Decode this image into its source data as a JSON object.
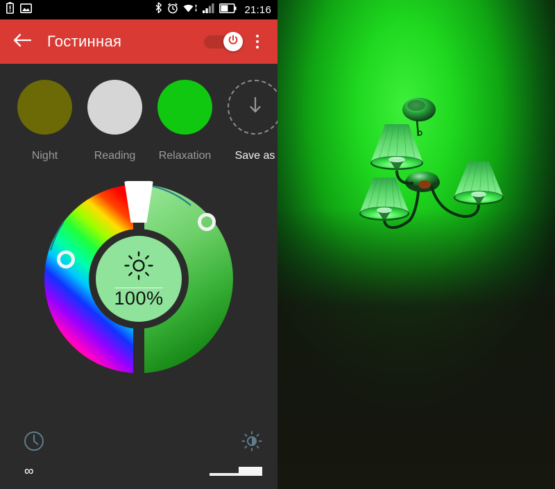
{
  "statusbar": {
    "icons_left": [
      "battery-alert-icon",
      "screenshot-icon"
    ],
    "icons_right": [
      "bluetooth-icon",
      "alarm-icon",
      "wifi-icon",
      "signal-icon",
      "battery-icon"
    ],
    "time": "21:16"
  },
  "appbar": {
    "back_icon": "back-arrow-icon",
    "title": "Гостинная",
    "power_toggle": {
      "state": "on",
      "icon": "power-icon"
    },
    "overflow_icon": "overflow-menu-icon",
    "bg_color": "#d93a33"
  },
  "presets": [
    {
      "label": "Night",
      "color": "#6b6a07",
      "type": "color"
    },
    {
      "label": "Reading",
      "color": "#d6d6d6",
      "type": "color"
    },
    {
      "label": "Relaxation",
      "color": "#10c810",
      "type": "color"
    },
    {
      "label": "Save as",
      "color": "",
      "type": "save",
      "icon": "down-arrow-icon"
    }
  ],
  "color_wheel": {
    "hue_ring_label": "hue-gradient-ring",
    "saturation_ring_label": "green-saturation-ring",
    "selected_color": "#4fc64f",
    "white_tab_label": "white-light-tab",
    "hue_handle": "hue-handle",
    "saturation_handle": "saturation-handle",
    "center": {
      "icon": "brightness-sun-icon",
      "value": "100%",
      "bg_color": "#8fe39a"
    }
  },
  "bottombar": {
    "timer": {
      "icon": "clock-icon",
      "label": "∞"
    },
    "brightness": {
      "icon": "brightness-contrast-icon",
      "slider_value": "high"
    },
    "icon_color": "#5f7d8c"
  },
  "photo": {
    "name": "chandelier-green-light-photo",
    "description": "Ceiling chandelier with three fabric shades glowing green",
    "glow_color": "#13c813",
    "wall_dark": "#14170f"
  }
}
